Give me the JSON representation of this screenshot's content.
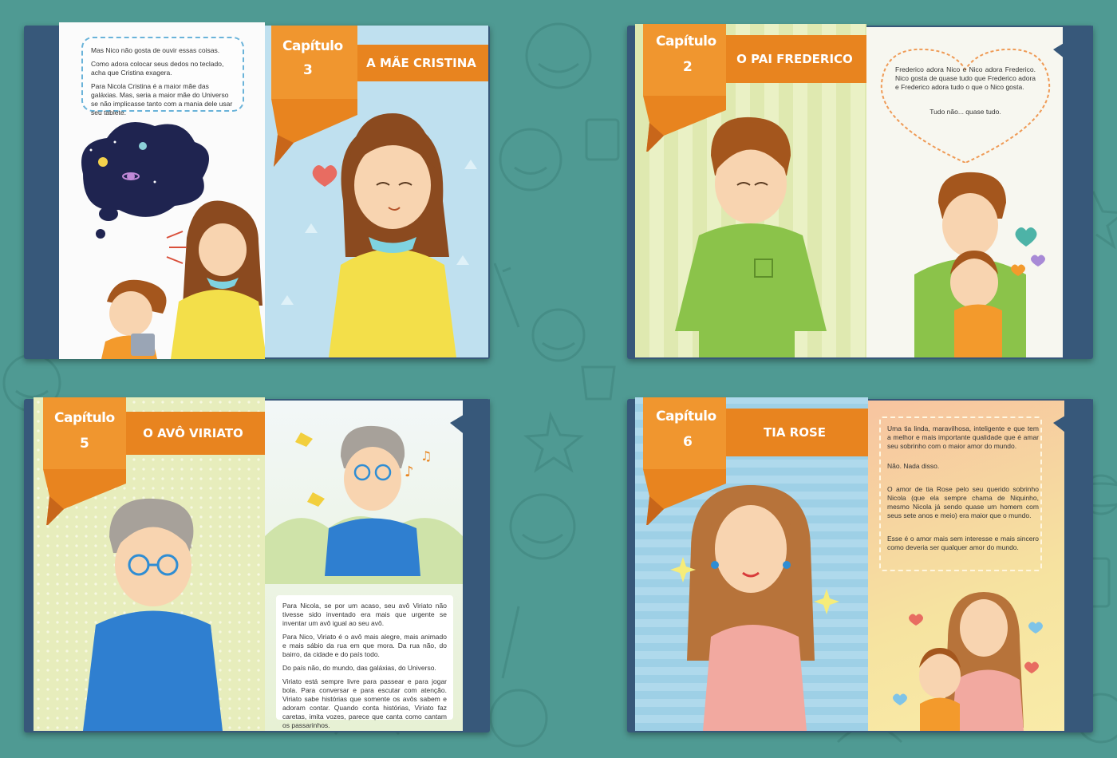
{
  "palette": {
    "background": "#4f9a93",
    "cover": "#37587a",
    "orange": "#e8841f",
    "ribbon_dark": "#c8661a"
  },
  "books": [
    {
      "chapter_word": "Capítulo",
      "chapter_number": "3",
      "title": "A MÃE CRISTINA",
      "text": [
        "Mas Nico não gosta de ouvir essas coisas.",
        "Como adora colocar seus dedos no teclado, acha que Cristina exagera.",
        "Para Nicola Cristina é a maior mãe das galáxias. Mas, seria a maior mãe do Universo se não implicasse tanto com a mania dele usar seu tablete."
      ]
    },
    {
      "chapter_word": "Capítulo",
      "chapter_number": "2",
      "title": "O PAI FREDERICO",
      "text": [
        "Frederico adora Nico e Nico adora Frederico. Nico gosta de quase tudo que Frederico adora e Frederico adora tudo o que o Nico gosta.",
        "Tudo não... quase tudo."
      ]
    },
    {
      "chapter_word": "Capítulo",
      "chapter_number": "5",
      "title": "O AVÔ VIRIATO",
      "text": [
        "Para Nicola, se por um acaso, seu avô Viriato não tivesse sido inventado era mais que urgente se inventar um avô igual ao seu avô.",
        "Para Nico, Viriato é o avô mais alegre, mais animado e mais sábio da rua em que mora. Da rua não, do bairro, da cidade e do país todo.",
        "Do país não, do mundo, das galáxias, do Universo.",
        "Viriato está sempre livre para passear e para jogar bola. Para conversar e para escutar com atenção. Viriato sabe histórias que somente os avôs sabem e adoram contar. Quando conta histórias, Viriato faz caretas, imita vozes, parece que canta como cantam os passarinhos."
      ]
    },
    {
      "chapter_word": "Capítulo",
      "chapter_number": "6",
      "title": "TIA ROSE",
      "text": [
        "Uma tia linda, maravilhosa, inteligente e que tem a melhor e mais importante qualidade que é amar seu sobrinho com o maior amor do mundo.",
        "Não. Nada disso.",
        "O amor de tia Rose pelo seu querido sobrinho Nicola (que ela sempre chama de Niquinho, mesmo Nicola já sendo quase um homem com seus sete anos e meio) era maior que o mundo.",
        "Esse é o amor mais sem interesse e mais sincero como deveria ser qualquer amor do mundo."
      ]
    }
  ]
}
